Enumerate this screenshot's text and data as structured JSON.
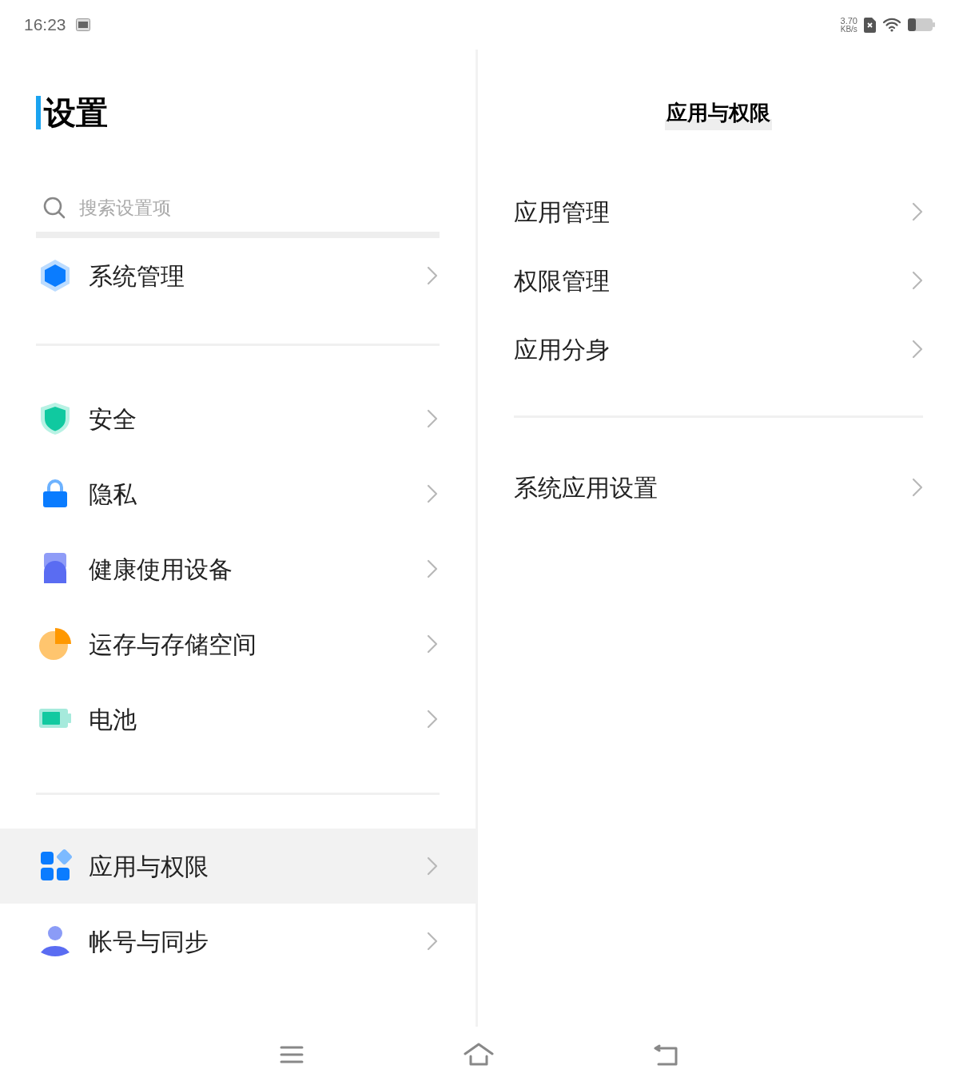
{
  "status_bar": {
    "time": "16:23",
    "speed": "3.70",
    "speed_unit": "KB/s"
  },
  "sidebar": {
    "title": "设置",
    "search": {
      "placeholder": "搜索设置项"
    },
    "groups": [
      [
        {
          "label": "系统管理",
          "selected": false
        }
      ],
      [
        {
          "label": "安全",
          "selected": false
        },
        {
          "label": "隐私",
          "selected": false
        },
        {
          "label": "健康使用设备",
          "selected": false
        },
        {
          "label": "运存与存储空间",
          "selected": false
        },
        {
          "label": "电池",
          "selected": false
        }
      ],
      [
        {
          "label": "应用与权限",
          "selected": true
        },
        {
          "label": "帐号与同步",
          "selected": false
        }
      ]
    ]
  },
  "detail": {
    "title": "应用与权限",
    "groups": [
      [
        "应用管理",
        "权限管理",
        "应用分身"
      ],
      [
        "系统应用设置"
      ]
    ]
  }
}
